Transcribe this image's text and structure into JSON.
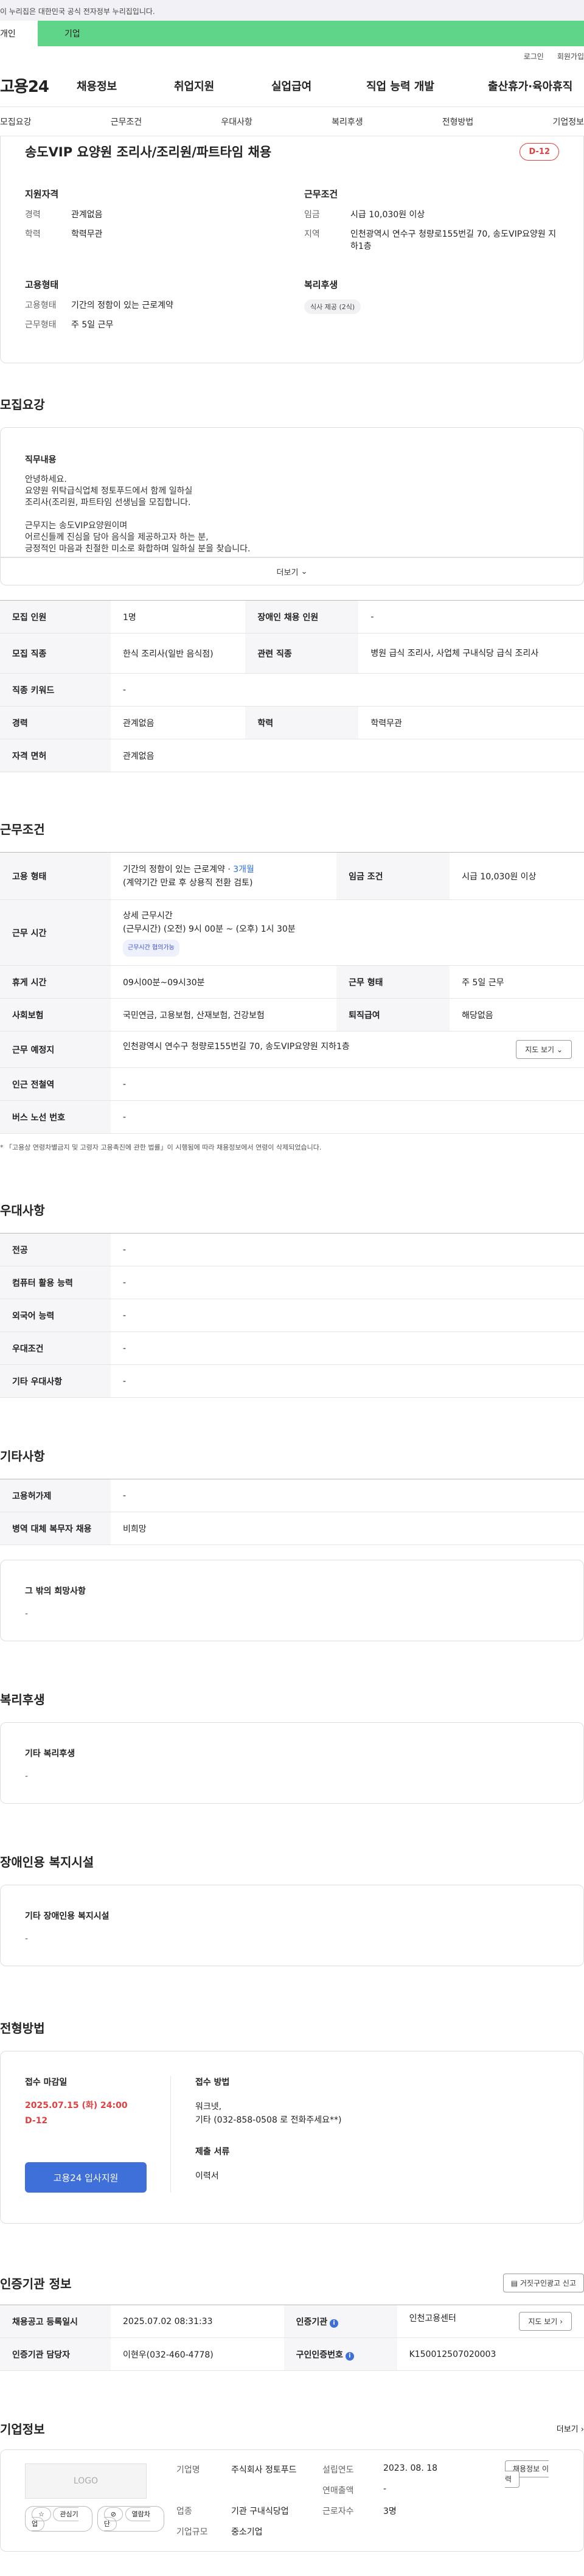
{
  "banner": {
    "text": "이 누리집은 대한민국 공식 전자정부 누리집입니다."
  },
  "tabs": {
    "personal": "개인",
    "corporate": "기업"
  },
  "util": {
    "login": "로그인",
    "join": "회원가입"
  },
  "gnb": {
    "logo": "고용24",
    "items": [
      "채용정보",
      "취업지원",
      "실업급여",
      "직업 능력 개발",
      "출산휴가·육아휴직"
    ]
  },
  "lnb": [
    "모집요강",
    "근무조건",
    "우대사항",
    "복리후생",
    "전형방법",
    "기업정보"
  ],
  "job": {
    "title": "송도VIP 요양원 조리사/조리원/파트타임 채용",
    "dday": "D-12",
    "qual_title": "지원자격",
    "qual": [
      {
        "k": "경력",
        "v": "관계없음"
      },
      {
        "k": "학력",
        "v": "학력무관"
      }
    ],
    "cond_title": "근무조건",
    "cond": [
      {
        "k": "임금",
        "v": "시급 10,030원 이상"
      },
      {
        "k": "지역",
        "v": "인천광역시 연수구 청량로155번길 70, 송도VIP요양원 지하1층"
      }
    ],
    "emp_title": "고용형태",
    "emp": [
      {
        "k": "고용형태",
        "v": "기간의 정함이 있는 근로계약"
      },
      {
        "k": "근무형태",
        "v": "주 5일 근무"
      }
    ],
    "welfare_title": "복리후생",
    "welfare_pill": "식사 제공 (2식)"
  },
  "recruit": {
    "title": "모집요강",
    "desc_title": "직무내용",
    "desc": "안녕하세요.\n요양원 위탁급식업체 정토푸드에서 함께 일하실\n조리사(조리원, 파트타임 선생님을 모집합니다.\n\n근무지는 송도VIP요양원이며\n어르신들께 진심을 담아 음식을 제공하고자 하는 분,\n긍정적인 마음과 친절한 미소로 화합하며 일하실 분을 찾습니다.\n\n문의는 언제든 편하게 전화주세요",
    "more": "더보기",
    "rows": [
      {
        "k1": "모집 인원",
        "v1": "1명",
        "k2": "장애인 채용 인원",
        "v2": "-"
      },
      {
        "k1": "모집 직종",
        "v1": "한식 조리사(일반 음식점)",
        "k2": "관련 직종",
        "v2": "병원 급식 조리사, 사업체 구내식당 급식 조리사"
      },
      {
        "k1": "직종 키워드",
        "v1": "-"
      },
      {
        "k1": "경력",
        "v1": "관계없음",
        "k2": "학력",
        "v2": "학력무관"
      },
      {
        "k1": "자격 면허",
        "v1": "관계없음"
      }
    ]
  },
  "work": {
    "title": "근무조건",
    "emp_k": "고용 형태",
    "emp_v1": "기간의 정함이 있는 근로계약 · ",
    "emp_v1b": "3개월",
    "emp_v2": "(계약기간 만료 후 상용직 전환 검토)",
    "wage_k": "임금 조건",
    "wage_v": "시급 10,030원 이상",
    "time_k": "근무 시간",
    "time_t": "상세 근무시간",
    "time_v": "(근무시간) (오전) 9시 00분 ~ (오후) 1시 30분",
    "time_pill": "근무시간 협의가능",
    "rest_k": "휴게 시간",
    "rest_v": "09시00분~09시30분",
    "form_k": "근무 형태",
    "form_v": "주 5일 근무",
    "ins_k": "사회보험",
    "ins_v": "국민연금, 고용보험, 산재보험, 건강보험",
    "sev_k": "퇴직급여",
    "sev_v": "해당없음",
    "loc_k": "근무 예정지",
    "loc_v": "인천광역시 연수구 청량로155번길 70, 송도VIP요양원 지하1층",
    "map": "지도 보기",
    "sub_k": "인근 전철역",
    "sub_v": "-",
    "bus_k": "버스 노선 번호",
    "bus_v": "-",
    "note": "* 「고용상 연령차별금지 및 고령자 고용촉진에 관한 법률」이 시행됨에 따라 채용정보에서 연령이 삭제되었습니다."
  },
  "pref": {
    "title": "우대사항",
    "rows": [
      {
        "k": "전공",
        "v": "-"
      },
      {
        "k": "컴퓨터 활용 능력",
        "v": "-"
      },
      {
        "k": "외국어 능력",
        "v": "-"
      },
      {
        "k": "우대조건",
        "v": "-"
      },
      {
        "k": "기타 우대사항",
        "v": "-"
      }
    ]
  },
  "etc": {
    "title": "기타사항",
    "rows": [
      {
        "k": "고용허가제",
        "v": "-"
      },
      {
        "k": "병역 대체 복무자 채용",
        "v": "비희망"
      }
    ],
    "extra_title": "그 밖의 희망사항",
    "extra_v": "-"
  },
  "benefits": {
    "title": "복리후생",
    "sub": "기타 복리후생",
    "v": "-"
  },
  "disabled": {
    "title": "장애인용 복지시설",
    "sub": "기타 장애인용 복지시설",
    "v": "-"
  },
  "selection": {
    "title": "전형방법",
    "deadline_t": "접수 마감일",
    "deadline_v": "2025.07.15 (화) 24:00",
    "dday": "D-12",
    "apply_btn": "고용24 입사지원",
    "method_t": "접수 방법",
    "method_v1": "워크넷,",
    "method_v2": "기타 (032-858-0508 로 전화주세요**)",
    "doc_t": "제출 서류",
    "doc_v": "이력서"
  },
  "cert": {
    "title": "인증기관 정보",
    "report": "거짓구인광고 신고",
    "reg_k": "채용공고 등록일시",
    "reg_v": "2025.07.02 08:31:33",
    "org_k": "인증기관",
    "org_v": "인천고용센터",
    "map": "지도 보기",
    "mgr_k": "인증기관 담당자",
    "mgr_v": "이현우(032-460-4778)",
    "num_k": "구인인증번호",
    "num_v": "K150012507020003"
  },
  "corp": {
    "title": "기업정보",
    "more": "더보기",
    "logo": "LOGO",
    "fav": "관심기업",
    "block": "열람차단",
    "name_k": "기업명",
    "name_v": "주식회사 정토푸드",
    "year_k": "설립연도",
    "year_v": "2023. 08. 18",
    "sales_k": "연매출액",
    "sales_v": "-",
    "ind_k": "업종",
    "ind_v": "기관 구내식당업",
    "emp_k": "근로자수",
    "emp_v": "3명",
    "size_k": "기업규모",
    "size_v": "중소기업",
    "jobs_btn": "채용정보 이력"
  }
}
